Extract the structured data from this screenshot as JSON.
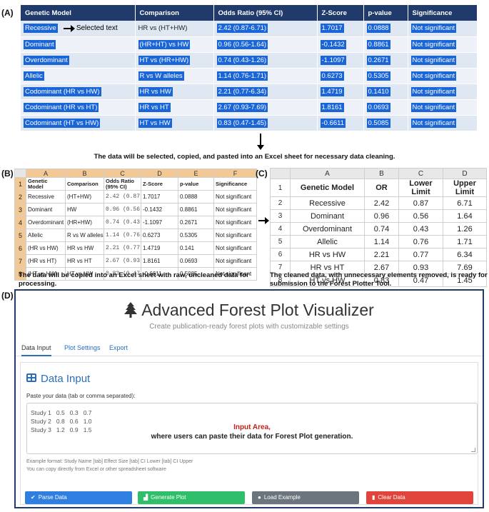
{
  "labels": {
    "a": "(A)",
    "b": "(B)",
    "c": "(C)",
    "d": "(D)"
  },
  "panelA": {
    "headers": [
      "Genetic Model",
      "Comparison",
      "Odds Ratio (95% CI)",
      "Z-Score",
      "p-value",
      "Significance"
    ],
    "annotation": "Selected text",
    "rows": [
      [
        "Recessive",
        "HR vs (HT+HW)",
        "2.42 (0.87-6.71)",
        "1.7017",
        "0.0888",
        "Not significant"
      ],
      [
        "Dominant",
        "(HR+HT) vs HW",
        "0.96 (0.56-1.64)",
        "-0.1432",
        "0.8861",
        "Not significant"
      ],
      [
        "Overdominant",
        "HT vs (HR+HW)",
        "0.74 (0.43-1.26)",
        "-1.1097",
        "0.2671",
        "Not significant"
      ],
      [
        "Allelic",
        "R vs W alleles",
        "1.14 (0.76-1.71)",
        "0.6273",
        "0.5305",
        "Not significant"
      ],
      [
        "Codominant (HR vs HW)",
        "HR vs HW",
        "2.21 (0.77-6.34)",
        "1.4719",
        "0.1410",
        "Not significant"
      ],
      [
        "Codominant (HR vs HT)",
        "HR vs HT",
        "2.67 (0.93-7.69)",
        "1.8161",
        "0.0693",
        "Not significant"
      ],
      [
        "Codominant (HT vs HW)",
        "HT vs HW",
        "0.83 (0.47-1.45)",
        "-0.6611",
        "0.5085",
        "Not significant"
      ]
    ]
  },
  "caption_a": "The data will be selected, copied, and pasted into an Excel sheet for necessary data cleaning.",
  "panelB": {
    "cols": [
      "A",
      "B",
      "C",
      "D",
      "E",
      "F"
    ],
    "rownums": [
      "1",
      "2",
      "3",
      "4",
      "5",
      "6",
      "7",
      "8"
    ],
    "headers": [
      "Genetic Model",
      "Comparison",
      "Odds Ratio (95% CI)",
      "Z-Score",
      "p-value",
      "Significance"
    ],
    "rows": [
      [
        "Recessive",
        "(HT+HW)",
        "2.42 (0.87-",
        "1.7017",
        "0.0888",
        "Not significant"
      ],
      [
        "Dominant",
        "HW",
        "0.96 (0.56-",
        "-0.1432",
        "0.8861",
        "Not significant"
      ],
      [
        "Overdominant",
        "(HR+HW)",
        "0.74 (0.43-",
        "-1.1097",
        "0.2671",
        "Not significant"
      ],
      [
        "Allelic",
        "R vs W alleles",
        "1.14 (0.76-",
        "0.6273",
        "0.5305",
        "Not significant"
      ],
      [
        "(HR vs HW)",
        "HR vs HW",
        "2.21 (0.77-",
        "1.4719",
        "0.141",
        "Not significant"
      ],
      [
        "(HR vs HT)",
        "HR vs HT",
        "2.67 (0.93-",
        "1.8161",
        "0.0693",
        "Not significant"
      ],
      [
        "(HT vs HW)",
        "HT vs HW",
        "0.83 (0.47-",
        "-0.6611",
        "0.5085",
        "Not significant"
      ]
    ],
    "caption": "The data will be copied into an Excel sheet with raw, uncleaned data for processing."
  },
  "panelC": {
    "cols": [
      "A",
      "B",
      "C",
      "D"
    ],
    "rownums": [
      "1",
      "2",
      "3",
      "4",
      "5",
      "6",
      "7",
      "8"
    ],
    "headers": [
      "Genetic Model",
      "OR",
      "Lower Limit",
      "Upper Limit"
    ],
    "rows": [
      [
        "Recessive",
        "2.42",
        "0.87",
        "6.71"
      ],
      [
        "Dominant",
        "0.96",
        "0.56",
        "1.64"
      ],
      [
        "Overdominant",
        "0.74",
        "0.43",
        "1.26"
      ],
      [
        "Allelic",
        "1.14",
        "0.76",
        "1.71"
      ],
      [
        "HR vs HW",
        "2.21",
        "0.77",
        "6.34"
      ],
      [
        "HR vs HT",
        "2.67",
        "0.93",
        "7.69"
      ],
      [
        "HT vs HW",
        "0.83",
        "0.47",
        "1.45"
      ]
    ],
    "caption": "The cleaned data, with unnecessary elements removed, is ready for submission to the Forest Plotter Tool."
  },
  "app": {
    "title": "Advanced Forest Plot Visualizer",
    "subtitle": "Create publication-ready forest plots with customizable settings",
    "tabs": [
      "Data Input",
      "Plot Settings",
      "Export"
    ],
    "card_title": "Data Input",
    "paste_label": "Paste your data (tab or comma separated):",
    "sample_lines": [
      "Study 1   0.5   0.3   0.7",
      "Study 2   0.8   0.6   1.0",
      "Study 3   1.2   0.9   1.5"
    ],
    "input_area_title": "Input Area,",
    "input_area_desc": "where users can paste their data for Forest Plot generation.",
    "hint1": "Example format: Study Name [tab] Effect Size [tab] CI Lower [tab] CI Upper",
    "hint2": "You can copy directly from Excel or other spreadsheet software",
    "buttons": {
      "parse": "Parse Data",
      "generate": "Generate Plot",
      "load": "Load Example",
      "clear": "Clear Data"
    },
    "button_icons": {
      "parse": "✔",
      "generate": "▟",
      "load": "●",
      "clear": "▮"
    },
    "colors": {
      "accent": "#2a6ebb",
      "parse": "#2f7fe0",
      "generate": "#2fbf6a",
      "load": "#6c757d",
      "clear": "#e0443a"
    }
  }
}
